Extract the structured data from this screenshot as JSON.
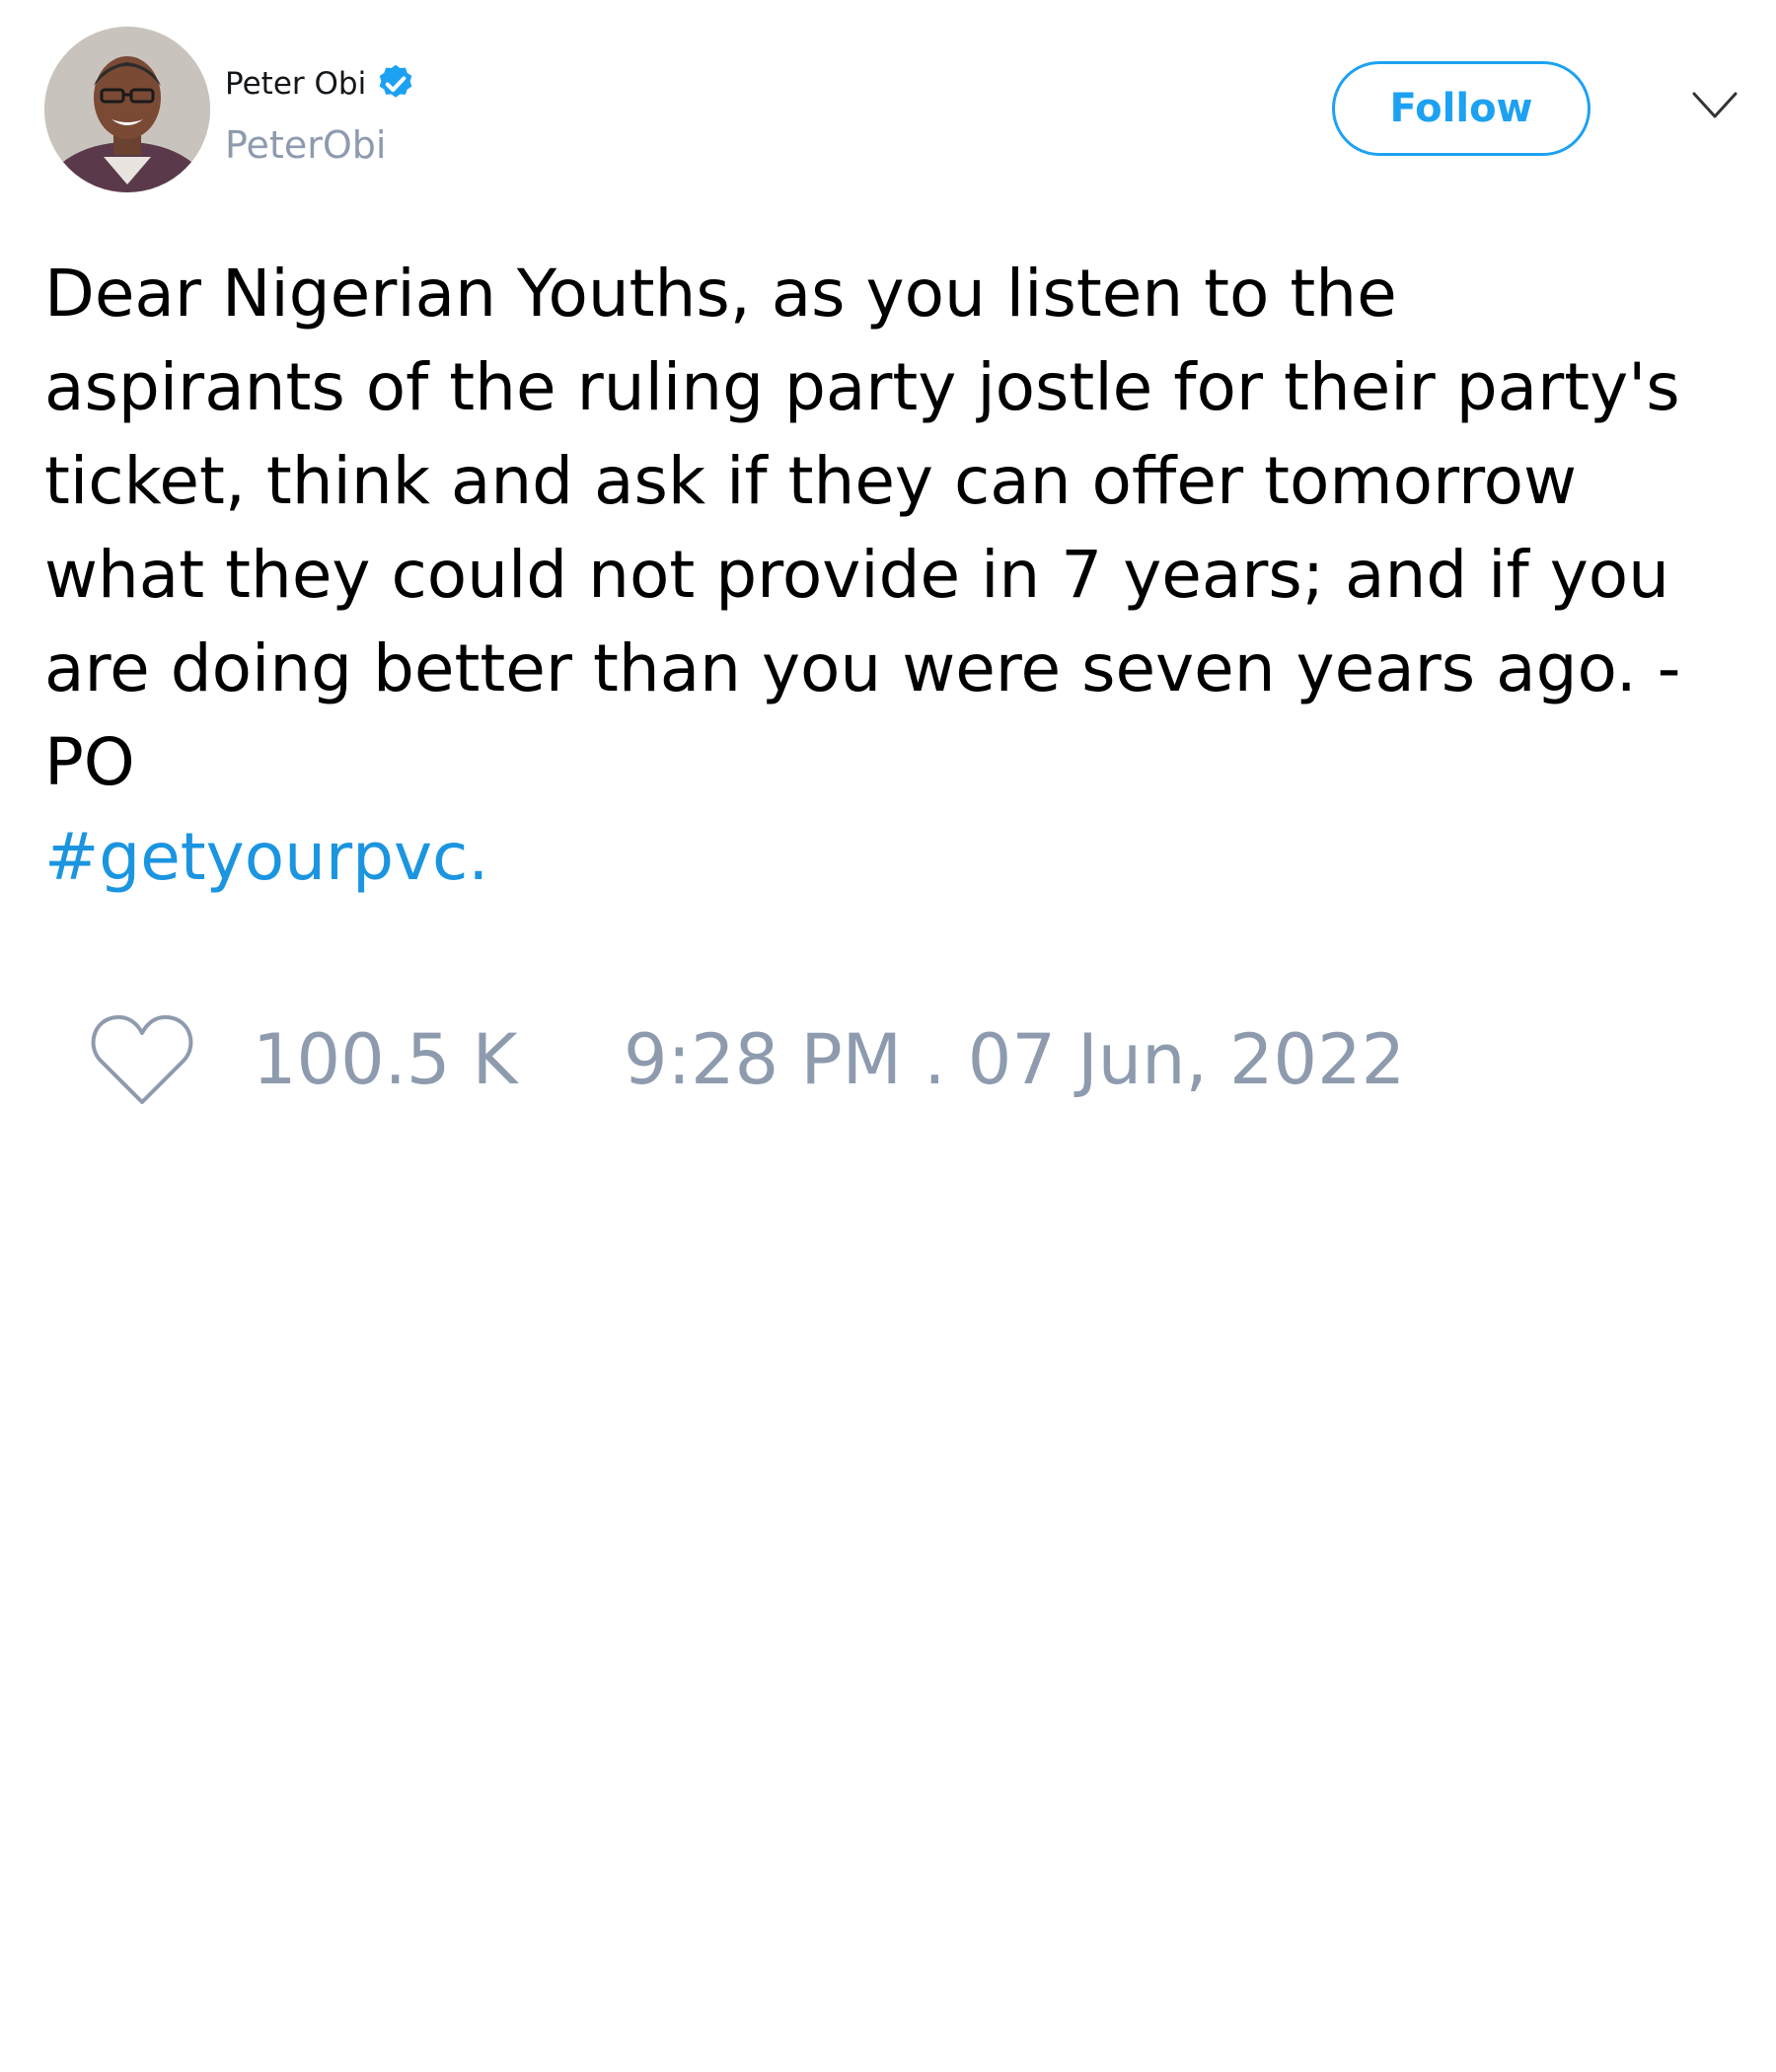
{
  "author": {
    "display_name": "Peter Obi",
    "handle": "PeterObi",
    "verified": true,
    "avatar_icon": "profile-photo"
  },
  "header": {
    "follow_label": "Follow",
    "menu_icon": "chevron-down-icon"
  },
  "tweet": {
    "text": "Dear Nigerian Youths, as you listen to the\naspirants of the ruling party jostle for their party's\nticket, think and ask if they can offer tomorrow\nwhat they could not provide in 7 years; and if you\nare doing better than you were seven years ago. -\nPO",
    "hashtag": "#getyourpvc."
  },
  "footer": {
    "like_icon": "heart-icon",
    "like_count": "100.5 K",
    "timestamp": "9:28 PM . 07 Jun, 2022"
  },
  "colors": {
    "accent": "#1da1f2",
    "hashtag": "#1b95e0",
    "muted": "#8e9bae",
    "text": "#000000"
  }
}
